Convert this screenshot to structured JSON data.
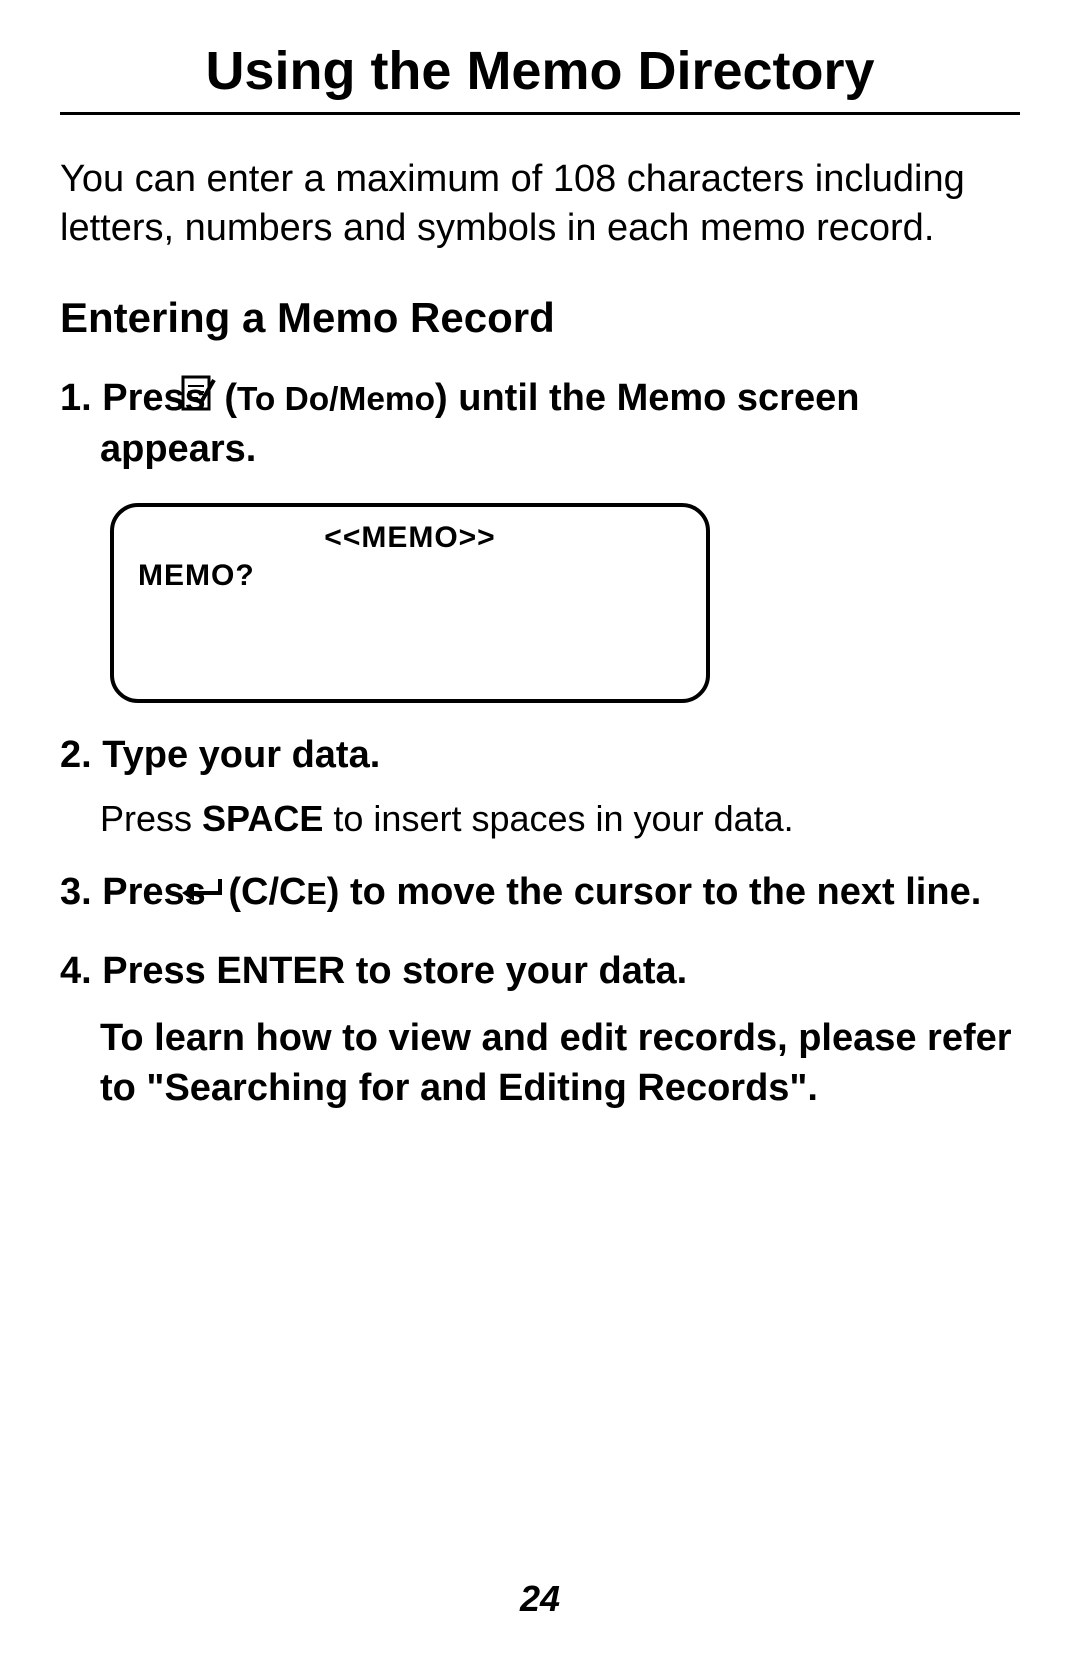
{
  "title": "Using the Memo Directory",
  "intro": "You can enter a maximum of 108 characters including letters, numbers and symbols in each memo record.",
  "sectionHeading": "Entering a Memo Record",
  "step1": {
    "prefix": "1. Press ",
    "iconLabel": "To Do/Memo",
    "suffix": ") until the Memo screen appears."
  },
  "screen": {
    "title": "<<MEMO>>",
    "prompt": "MEMO?"
  },
  "step2": {
    "main": "2. Type your data.",
    "subPrefix": "Press ",
    "subBold": "SPACE",
    "subSuffix": " to insert spaces in your data."
  },
  "step3": {
    "prefix": "3. Press ",
    "labelPart1": "(C/C",
    "labelSmall": "E",
    "suffix": ") to move the cursor to the next line."
  },
  "step4": {
    "main": "4. Press ENTER to store your data.",
    "note": "To learn how to view and edit records, please refer to \"Searching for and Editing Records\"."
  },
  "pageNumber": "24"
}
